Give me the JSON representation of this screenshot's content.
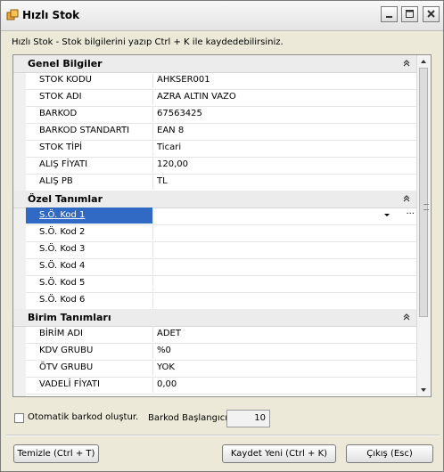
{
  "window": {
    "title": "Hızlı Stok"
  },
  "hint": "Hızlı Stok - Stok bilgilerini yazıp Ctrl + K ile kaydedebilirsiniz.",
  "grid": {
    "categories": [
      {
        "label": "Genel Bilgiler",
        "rows": [
          {
            "name": "STOK KODU",
            "value": "AHKSER001"
          },
          {
            "name": "STOK ADI",
            "value": "AZRA ALTIN VAZO"
          },
          {
            "name": "BARKOD",
            "value": "67563425"
          },
          {
            "name": "BARKOD STANDARTI",
            "value": "EAN 8"
          },
          {
            "name": "STOK TİPİ",
            "value": "Ticari"
          },
          {
            "name": "ALIŞ FİYATI",
            "value": "120,00"
          },
          {
            "name": "ALIŞ PB",
            "value": "TL"
          }
        ]
      },
      {
        "label": "Özel Tanımlar",
        "rows": [
          {
            "name": "S.Ö. Kod 1",
            "value": ""
          },
          {
            "name": "S.Ö. Kod 2",
            "value": ""
          },
          {
            "name": "S.Ö. Kod 3",
            "value": ""
          },
          {
            "name": "S.Ö. Kod 4",
            "value": ""
          },
          {
            "name": "S.Ö. Kod 5",
            "value": ""
          },
          {
            "name": "S.Ö. Kod 6",
            "value": ""
          }
        ]
      },
      {
        "label": "Birim Tanımları",
        "rows": [
          {
            "name": "BİRİM ADI",
            "value": "ADET"
          },
          {
            "name": "KDV GRUBU",
            "value": "%0"
          },
          {
            "name": "ÖTV GRUBU",
            "value": "YOK"
          },
          {
            "name": "VADELİ FİYATI",
            "value": "0,00"
          }
        ]
      }
    ],
    "selected_row_ellipsis": "···"
  },
  "options": {
    "auto_barcode_label": "Otomatik barkod oluştur.",
    "auto_barcode_checked": false,
    "barcode_start_label": "Barkod Başlangıcı",
    "barcode_start_value": "10"
  },
  "buttons": {
    "clear": "Temizle (Ctrl + T)",
    "save_new": "Kaydet Yeni (Ctrl + K)",
    "exit": "Çıkış (Esc)"
  },
  "icons": {
    "app": "box-icon",
    "collapse": "collapse-chevrons-icon",
    "minimize": "minimize-icon",
    "maximize": "maximize-icon",
    "close": "close-icon"
  }
}
